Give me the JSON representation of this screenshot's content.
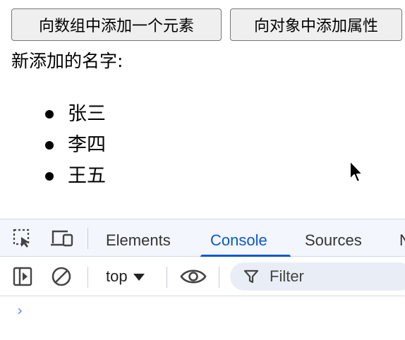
{
  "page": {
    "buttons": {
      "add_to_array": "向数组中添加一个元素",
      "add_property": "向对象中添加属性"
    },
    "label": "新添加的名字:",
    "names": [
      "张三",
      "李四",
      "王五"
    ]
  },
  "devtools": {
    "tabs": [
      "Elements",
      "Console",
      "Sources"
    ],
    "active_tab": "Console",
    "context_selector": "top",
    "filter_placeholder": "Filter",
    "prompt_symbol": "›",
    "accent_color": "#0b57d0",
    "icons": [
      "inspect-element-icon",
      "device-toggle-icon",
      "sidebar-toggle-icon",
      "clear-console-icon",
      "live-expression-eye-icon",
      "filter-icon"
    ]
  }
}
